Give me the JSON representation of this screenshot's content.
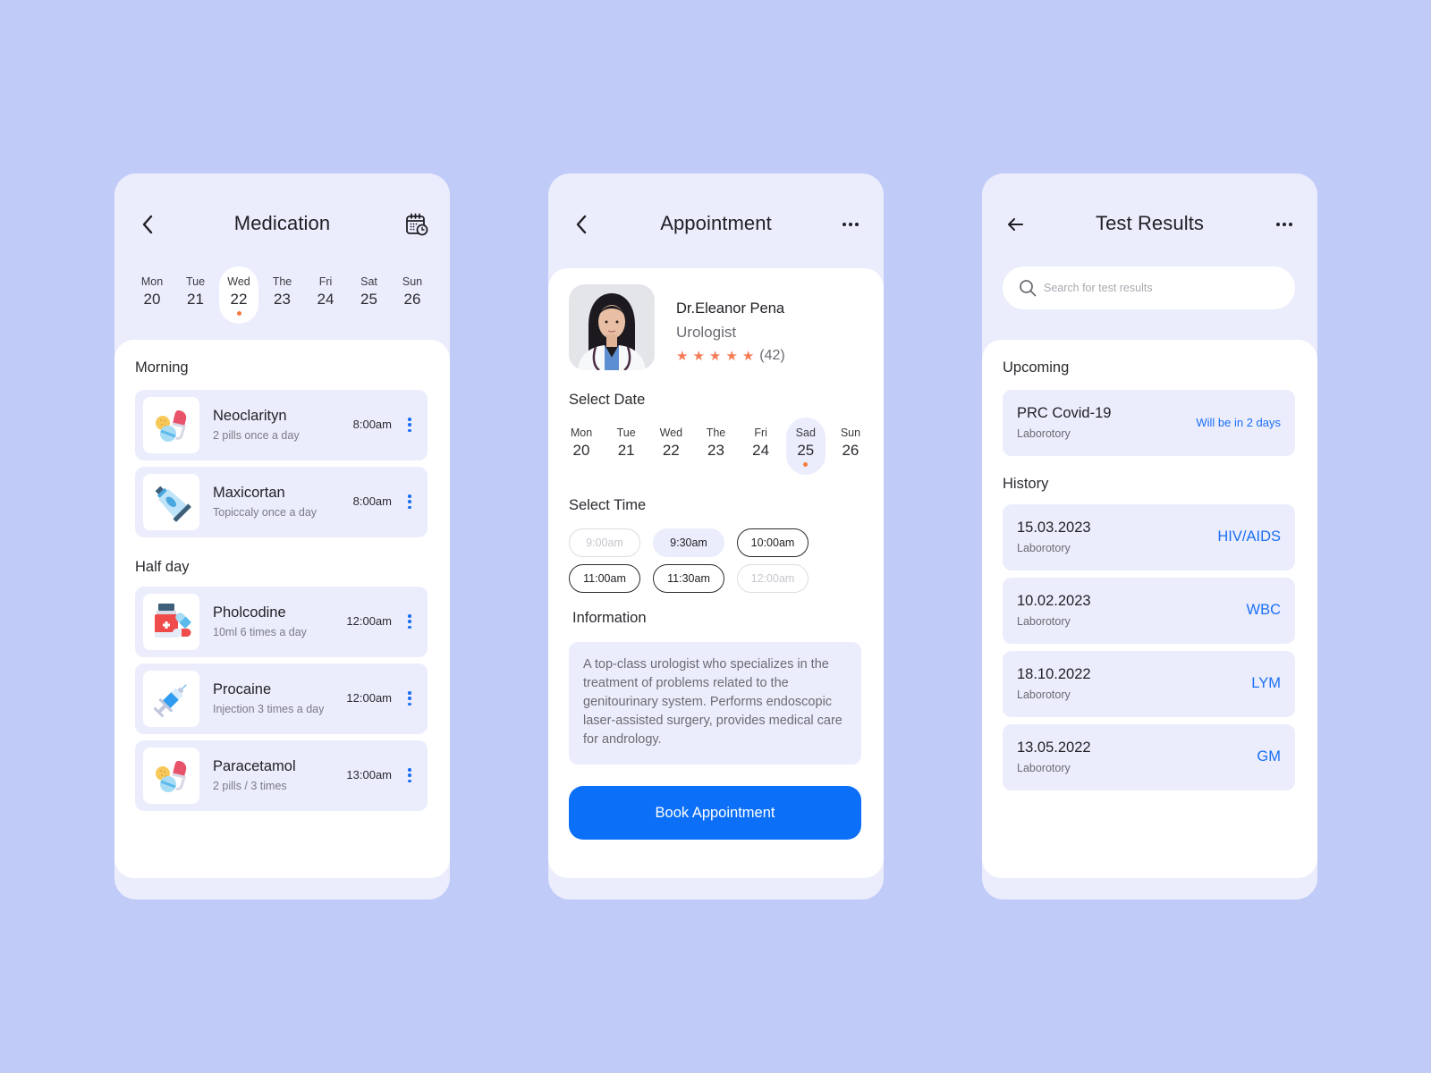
{
  "colors": {
    "background": "#c0cbf7",
    "card_background": "#ebedfc",
    "accent_blue": "#0b6ff7",
    "accent_orange": "#f47b3e",
    "star_color": "#f47b58"
  },
  "medication": {
    "title": "Medication",
    "back_icon": "chevron-left-icon",
    "calendar_icon": "calendar-clock-icon",
    "days": [
      {
        "name": "Mon",
        "num": "20"
      },
      {
        "name": "Tue",
        "num": "21"
      },
      {
        "name": "Wed",
        "num": "22",
        "active": true
      },
      {
        "name": "The",
        "num": "23"
      },
      {
        "name": "Fri",
        "num": "24"
      },
      {
        "name": "Sat",
        "num": "25"
      },
      {
        "name": "Sun",
        "num": "26"
      }
    ],
    "sections": [
      {
        "label": "Morning",
        "items": [
          {
            "name": "Neoclarityn",
            "dose": "2 pills once a day",
            "time": "8:00am",
            "icon": "pills-icon"
          },
          {
            "name": "Maxicortan",
            "dose": "Topiccaly once a day",
            "time": "8:00am",
            "icon": "ointment-tube-icon"
          }
        ]
      },
      {
        "label": "Half day",
        "items": [
          {
            "name": "Pholcodine",
            "dose": "10ml 6 times a day",
            "time": "12:00am",
            "icon": "medicine-bottle-icon"
          },
          {
            "name": "Procaine",
            "dose": "Injection 3 times a day",
            "time": "12:00am",
            "icon": "syringe-icon"
          },
          {
            "name": "Paracetamol",
            "dose": "2 pills / 3 times",
            "time": "13:00am",
            "icon": "pills-icon"
          }
        ]
      }
    ]
  },
  "appointment": {
    "title": "Appointment",
    "doctor": {
      "name": "Dr.Eleanor Pena",
      "specialty": "Urologist",
      "rating": 5,
      "rating_max": 5,
      "review_count": "(42)"
    },
    "select_date_label": "Select Date",
    "days": [
      {
        "name": "Mon",
        "num": "20"
      },
      {
        "name": "Tue",
        "num": "21"
      },
      {
        "name": "Wed",
        "num": "22"
      },
      {
        "name": "The",
        "num": "23"
      },
      {
        "name": "Fri",
        "num": "24"
      },
      {
        "name": "Sad",
        "num": "25",
        "active": true
      },
      {
        "name": "Sun",
        "num": "26"
      }
    ],
    "select_time_label": "Select Time",
    "times": [
      {
        "label": "9:00am",
        "state": "disabled"
      },
      {
        "label": "9:30am",
        "state": "selected"
      },
      {
        "label": "10:00am",
        "state": "available"
      },
      {
        "label": "11:00am",
        "state": "available"
      },
      {
        "label": "11:30am",
        "state": "available"
      },
      {
        "label": "12:00am",
        "state": "disabled"
      }
    ],
    "information_label": "Information",
    "information_text": "A top-class urologist who specializes in the treatment of problems related to the genitourinary system. Performs endoscopic laser-assisted surgery, provides medical care for andrology.",
    "book_button": "Book Appointment"
  },
  "test_results": {
    "title": "Test Results",
    "search_placeholder": "Search for test results",
    "upcoming_label": "Upcoming",
    "upcoming": [
      {
        "name": "PRC Covid-19",
        "sub": "Laborotory",
        "status": "Will be in 2 days"
      }
    ],
    "history_label": "History",
    "history": [
      {
        "date": "15.03.2023",
        "sub": "Laborotory",
        "tag": "HIV/AIDS"
      },
      {
        "date": "10.02.2023",
        "sub": "Laborotory",
        "tag": "WBC"
      },
      {
        "date": "18.10.2022",
        "sub": "Laborotory",
        "tag": "LYM"
      },
      {
        "date": "13.05.2022",
        "sub": "Laborotory",
        "tag": "GM"
      }
    ]
  }
}
